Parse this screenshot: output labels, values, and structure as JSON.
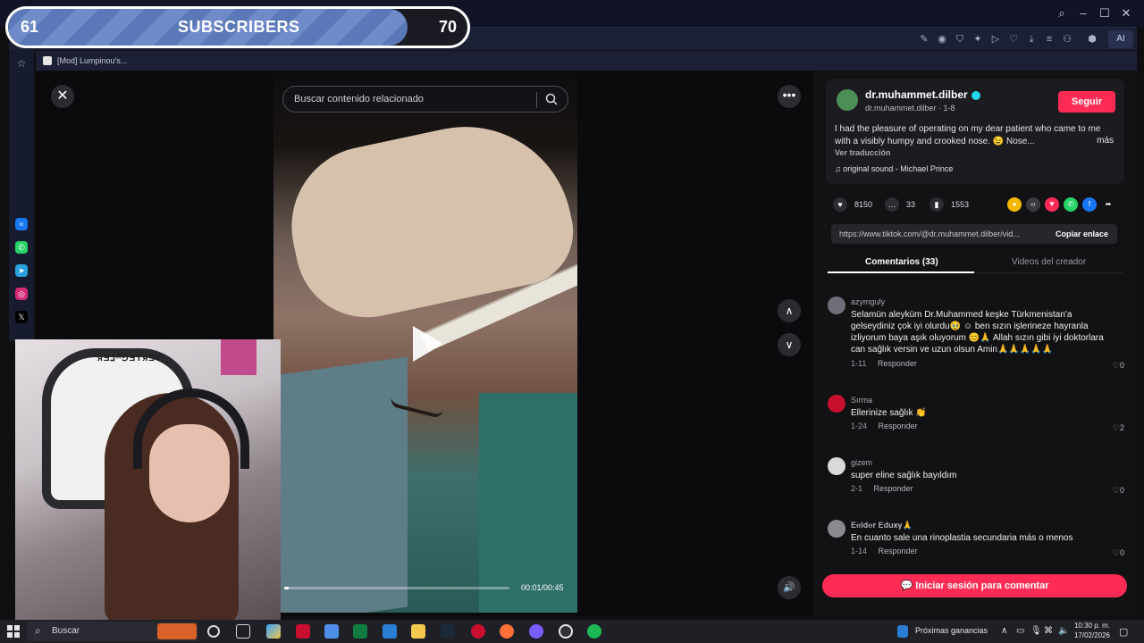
{
  "browser": {
    "tab_title": "[Mod] Lumpinou's...",
    "ai_button": "AI"
  },
  "overlay": {
    "sub_start": "61",
    "sub_label": "SUBSCRIBERS",
    "sub_end": "70",
    "progress_fraction": 0.87
  },
  "video": {
    "search_placeholder": "Buscar contenido relacionado",
    "timecode": "00:01/00:45",
    "progress_fraction": 0.02
  },
  "webcam": {
    "chair_text": "ᴙƎ⅃ᴬ⅁ƎTᴙƎV"
  },
  "post": {
    "author_name": "dr.muhammet.dilber",
    "author_sub": "dr.muhammet.dilber · 1-8",
    "follow_label": "Seguir",
    "caption": "I had the pleasure of operating on my dear patient who came to me with a visibly humpy and crooked nose. 😉 Nose...",
    "more_label": "más",
    "translate_label": "Ver traducción",
    "sound": "original sound - Michael Prince",
    "likes": "8150",
    "comments_count": "33",
    "saves": "1553",
    "link_url": "https://www.tiktok.com/@dr.muhammet.dilber/vid...",
    "copy_label": "Copiar enlace"
  },
  "tabs": {
    "comments": "Comentarios (33)",
    "creator_videos": "Videos del creador"
  },
  "comments": [
    {
      "user": "azymguly",
      "text": "Selamün aleyküm Dr.Muhammed keşke Türkmenistan'a gelseydiniz çok iyi olurdu🥹 ☺ ben sızın işlerineze hayranla izliyorum baya aşık oluyorum 😊🙏 Allah sızın gibi iyi doktorlara can sağlık versin ve uzun olsun Amin🙏🙏🙏🙏🙏",
      "date": "1-11",
      "reply": "Responder",
      "likes": "0"
    },
    {
      "user": "Sırma",
      "text": "Ellerinize sağlık 👏",
      "date": "1-24",
      "reply": "Responder",
      "likes": "2"
    },
    {
      "user": "gizem",
      "text": "super eline sağlık bayıldım",
      "date": "2-1",
      "reply": "Responder",
      "likes": "0"
    },
    {
      "user": "𝐄𝐞𝐥𝐝𝐞𝐫 𝐄𝐝𝐮𝐱̶𝐲̶🙏",
      "text": "En cuanto sale una rinoplastia secundaria más o menos",
      "date": "1-14",
      "reply": "Responder",
      "likes": "0"
    }
  ],
  "login_label": "Iniciar sesión para comentar",
  "taskbar": {
    "search_label": "Buscar",
    "earnings_label": "Próximas ganancias",
    "time": "10:30 p. m.",
    "date": "17/02/2026"
  },
  "colors": {
    "accent": "#fe2c55",
    "panel_bg": "#121214",
    "chrome_bg": "#1b2034"
  }
}
